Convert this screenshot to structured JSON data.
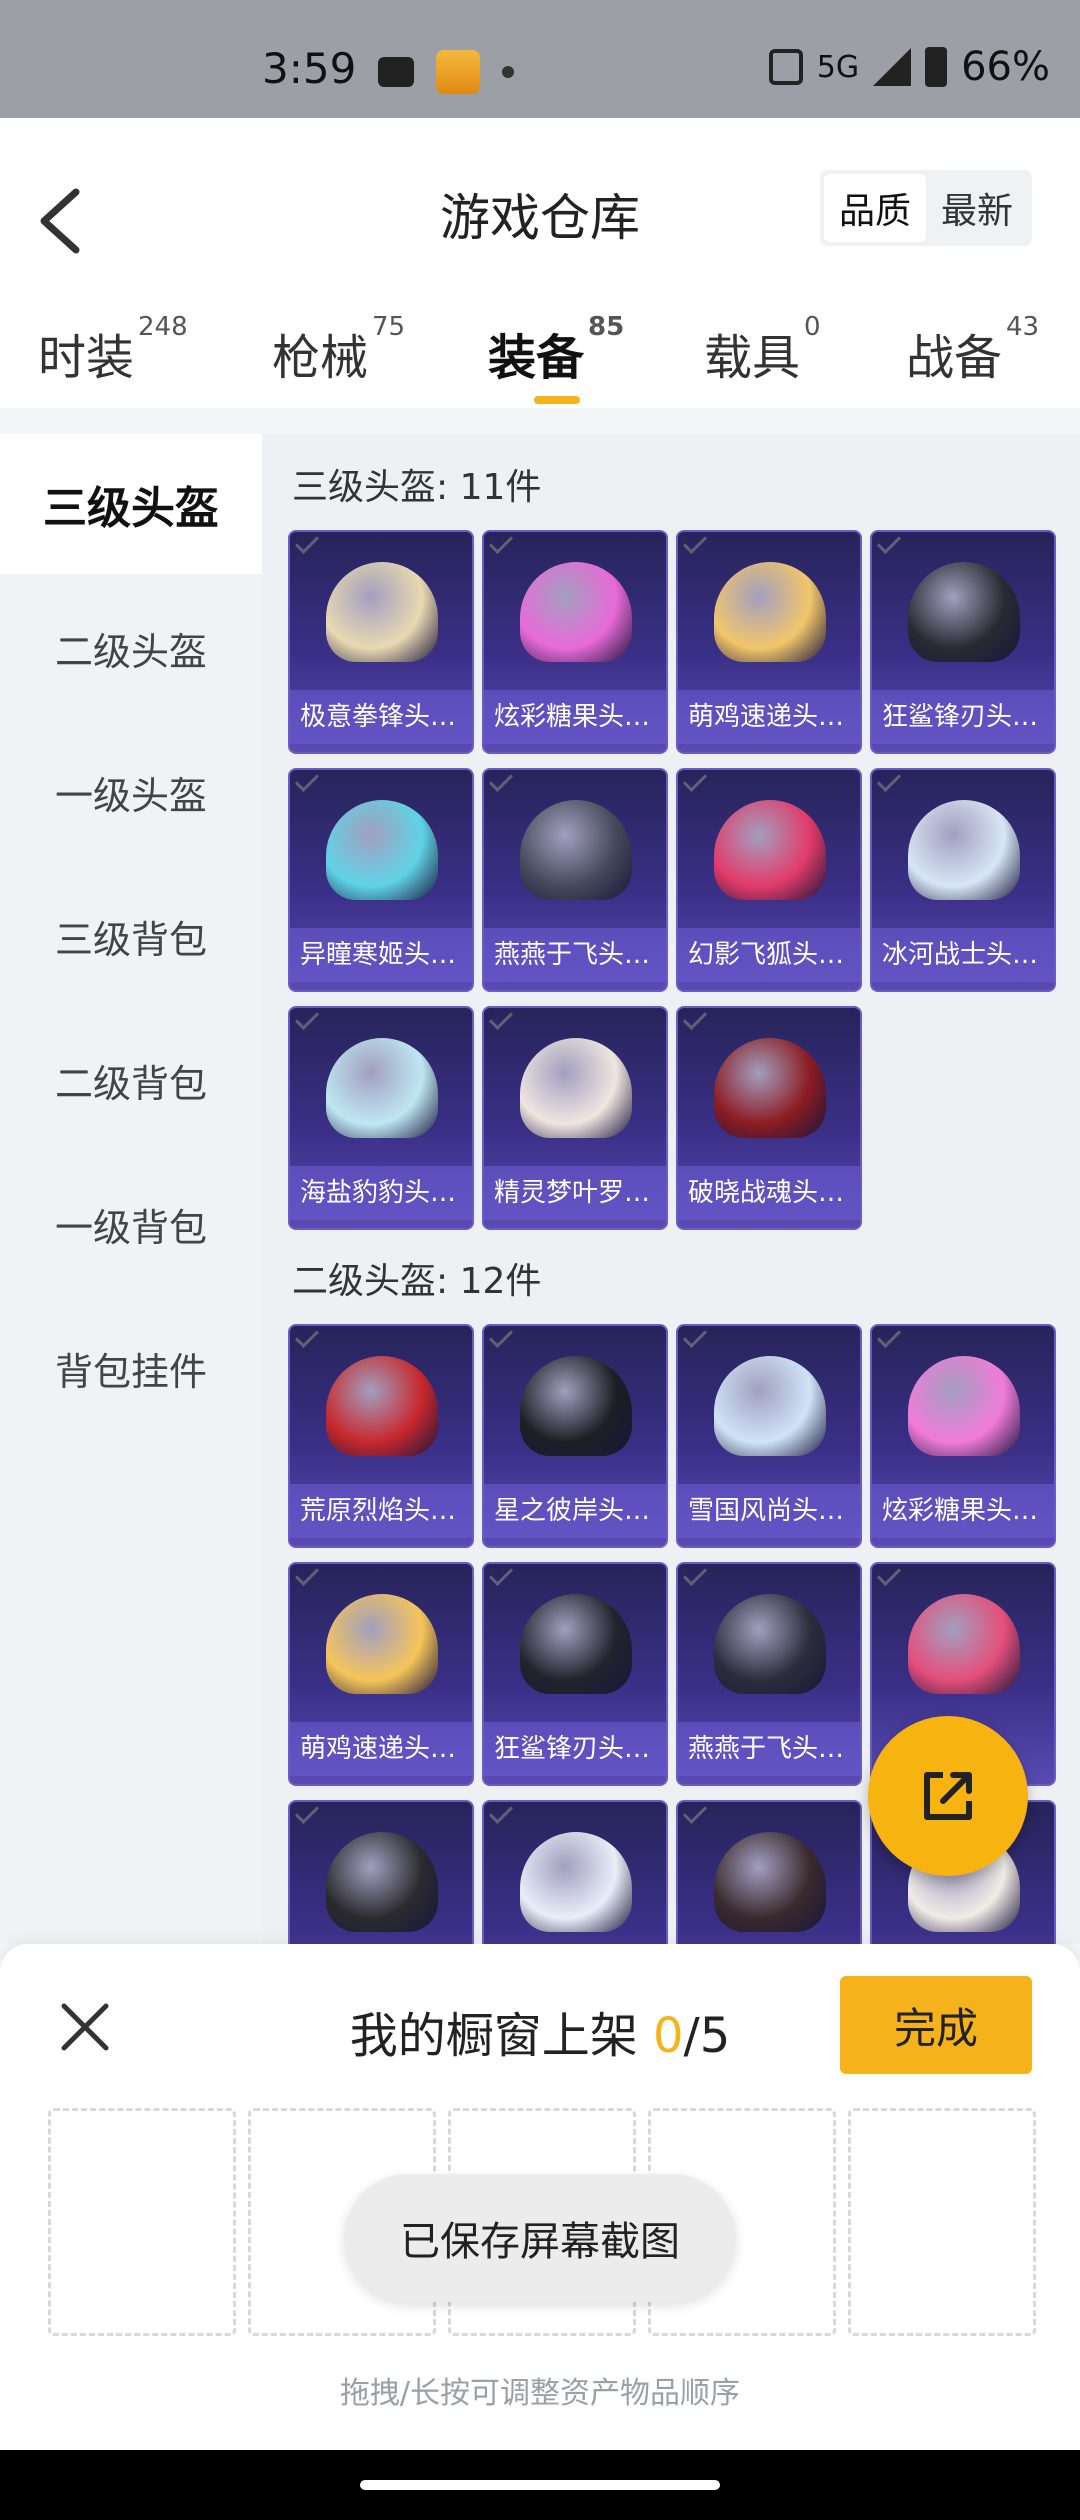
{
  "status_bar": {
    "time": "3:59",
    "network": "5G",
    "battery": "66%"
  },
  "header": {
    "title": "游戏仓库",
    "sort": [
      "品质",
      "最新"
    ],
    "tabs": [
      {
        "label": "时装",
        "count": "248"
      },
      {
        "label": "枪械",
        "count": "75"
      },
      {
        "label": "装备",
        "count": "85"
      },
      {
        "label": "载具",
        "count": "0"
      },
      {
        "label": "战备",
        "count": "43"
      }
    ]
  },
  "categories": [
    "三级头盔",
    "二级头盔",
    "一级头盔",
    "三级背包",
    "二级背包",
    "一级背包",
    "背包挂件"
  ],
  "sections": [
    {
      "title": "三级头盔: 11件",
      "items": [
        {
          "name": "极意拳锋头盔...",
          "color": "#e8d9b0"
        },
        {
          "name": "炫彩糖果头盔...",
          "color": "#e86ad8"
        },
        {
          "name": "萌鸡速递头盔...",
          "color": "#f2c66a"
        },
        {
          "name": "狂鲨锋刃头盔...",
          "color": "#2a2a33"
        },
        {
          "name": "异瞳寒姬头盔...",
          "color": "#5fd3e6"
        },
        {
          "name": "燕燕于飞头盔...",
          "color": "#444a5a"
        },
        {
          "name": "幻影飞狐头盔...",
          "color": "#e23b6a"
        },
        {
          "name": "冰河战士头盔...",
          "color": "#d7e6f5"
        },
        {
          "name": "海盐豹豹头盔...",
          "color": "#bfe7f2"
        },
        {
          "name": "精灵梦叶罗丽...",
          "color": "#efe6e0"
        },
        {
          "name": "破晓战魂头盔...",
          "color": "#8b1c22"
        }
      ]
    },
    {
      "title": "二级头盔: 12件",
      "items": [
        {
          "name": "荒原烈焰头盔...",
          "color": "#c7282d"
        },
        {
          "name": "星之彼岸头盔...",
          "color": "#1e1e24"
        },
        {
          "name": "雪国风尚头盔...",
          "color": "#cfe4f7"
        },
        {
          "name": "炫彩糖果头盔...",
          "color": "#f07bd9"
        },
        {
          "name": "萌鸡速递头盔...",
          "color": "#f5c55a"
        },
        {
          "name": "狂鲨锋刃头盔...",
          "color": "#23232d"
        },
        {
          "name": "燕燕于飞头盔...",
          "color": "#2b2e3c"
        },
        {
          "name": "",
          "color": "#e44f7b"
        },
        {
          "name": "",
          "color": "#2b2b2e"
        },
        {
          "name": "",
          "color": "#e8eef8"
        },
        {
          "name": "",
          "color": "#3a2a2e"
        },
        {
          "name": "",
          "color": "#f0ece6"
        }
      ]
    }
  ],
  "bottom_sheet": {
    "title_prefix": "我的橱窗上架 ",
    "count": "0",
    "total": "/5",
    "done": "完成",
    "hint": "拖拽/长按可调整资产物品顺序"
  },
  "toast": "已保存屏幕截图"
}
